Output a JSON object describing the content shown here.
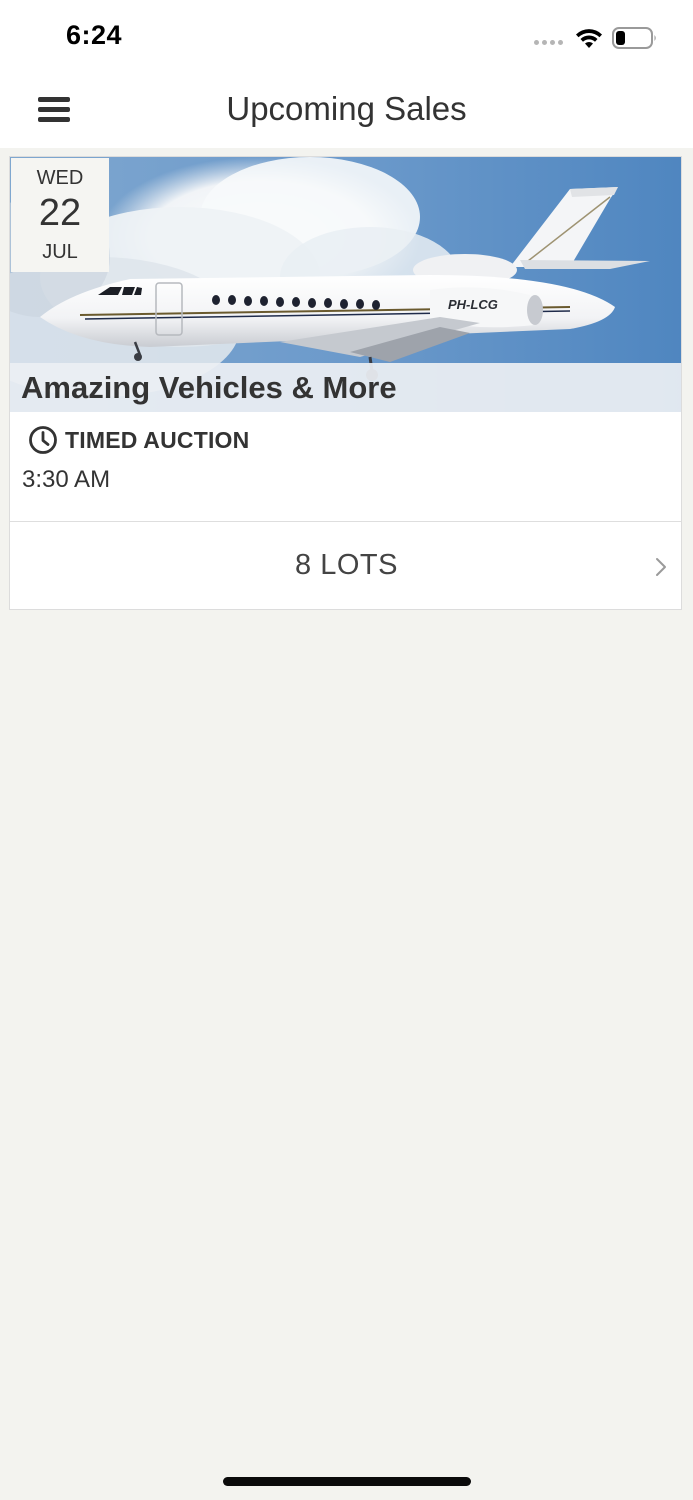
{
  "status_bar": {
    "time": "6:24"
  },
  "nav": {
    "title": "Upcoming Sales",
    "menu_icon": "hamburger-menu-icon"
  },
  "sales": [
    {
      "date": {
        "weekday": "WED",
        "day": "22",
        "month": "JUL"
      },
      "image": "business-jet-photo",
      "image_tail_text": "PH-LCG",
      "title": "Amazing Vehicles & More",
      "type_icon": "clock-icon",
      "type": "TIMED AUCTION",
      "time": "3:30 AM",
      "lots_label": "8 LOTS"
    }
  ],
  "colors": {
    "background": "#f3f3ef",
    "card": "#ffffff",
    "text": "#333333",
    "sky": "#5a8cc4",
    "title_strip": "#eceff3"
  }
}
